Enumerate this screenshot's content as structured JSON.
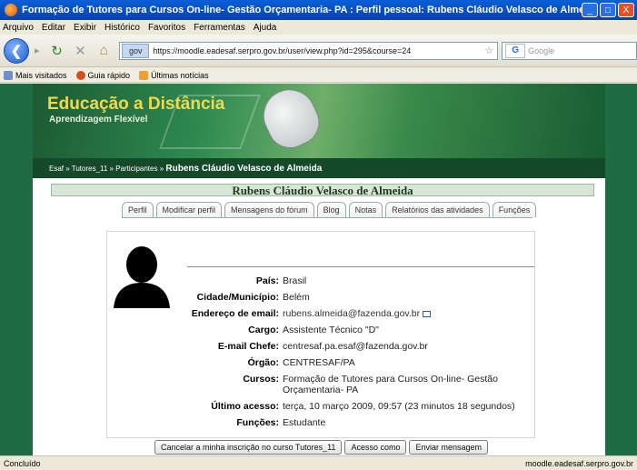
{
  "window": {
    "title": "Formação de Tutores para Cursos On-line- Gestão Orçamentaria- PA : Perfil pessoal: Rubens Cláudio Velasco de Almeida - Mozilla Firefox",
    "minimize": "_",
    "maximize": "□",
    "close": "X"
  },
  "menu": [
    "Arquivo",
    "Editar",
    "Exibir",
    "Histórico",
    "Favoritos",
    "Ferramentas",
    "Ajuda"
  ],
  "toolbar": {
    "url": "https://moodle.eadesaf.serpro.gov.br/user/view.php?id=295&course=24",
    "url_badge": "gov",
    "search_placeholder": "Google"
  },
  "bookmarks": [
    "Mais visitados",
    "Guia rápido",
    "Últimas notícias"
  ],
  "banner": {
    "title": "Educação a Distância",
    "subtitle": "Aprendizagem Flexível"
  },
  "breadcrumb": {
    "path": "Esaf » Tutores_11 » Participantes »",
    "current": "Rubens Cláudio Velasco de Almeida"
  },
  "user_heading": "Rubens Cláudio Velasco de Almeida",
  "tabs": [
    "Perfil",
    "Modificar perfil",
    "Mensagens do fórum",
    "Blog",
    "Notas",
    "Relatórios das atividades",
    "Funções"
  ],
  "profile": {
    "pais": {
      "label": "País:",
      "value": "Brasil"
    },
    "cidade": {
      "label": "Cidade/Município:",
      "value": "Belém"
    },
    "email": {
      "label": "Endereço de email:",
      "value": "rubens.almeida@fazenda.gov.br"
    },
    "cargo": {
      "label": "Cargo:",
      "value": "Assistente Técnico \"D\""
    },
    "email_chefe": {
      "label": "E-mail Chefe:",
      "value": "centresaf.pa.esaf@fazenda.gov.br"
    },
    "orgao": {
      "label": "Órgão:",
      "value": "CENTRESAF/PA"
    },
    "cursos": {
      "label": "Cursos:",
      "value": "Formação de Tutores para Cursos On-line- Gestão Orçamentaria- PA"
    },
    "ultimo_acesso": {
      "label": "Último acesso:",
      "value": "terça, 10 março 2009, 09:57  (23 minutos 18 segundos)"
    },
    "funcoes": {
      "label": "Funções:",
      "value": "Estudante"
    }
  },
  "actions": {
    "unenrol": "Cancelar a minha inscrição no curso Tutores_11",
    "login_as": "Acesso como",
    "send_message": "Enviar mensagem"
  },
  "status": {
    "left": "Concluído",
    "right": "moodle.eadesaf.serpro.gov.br"
  }
}
